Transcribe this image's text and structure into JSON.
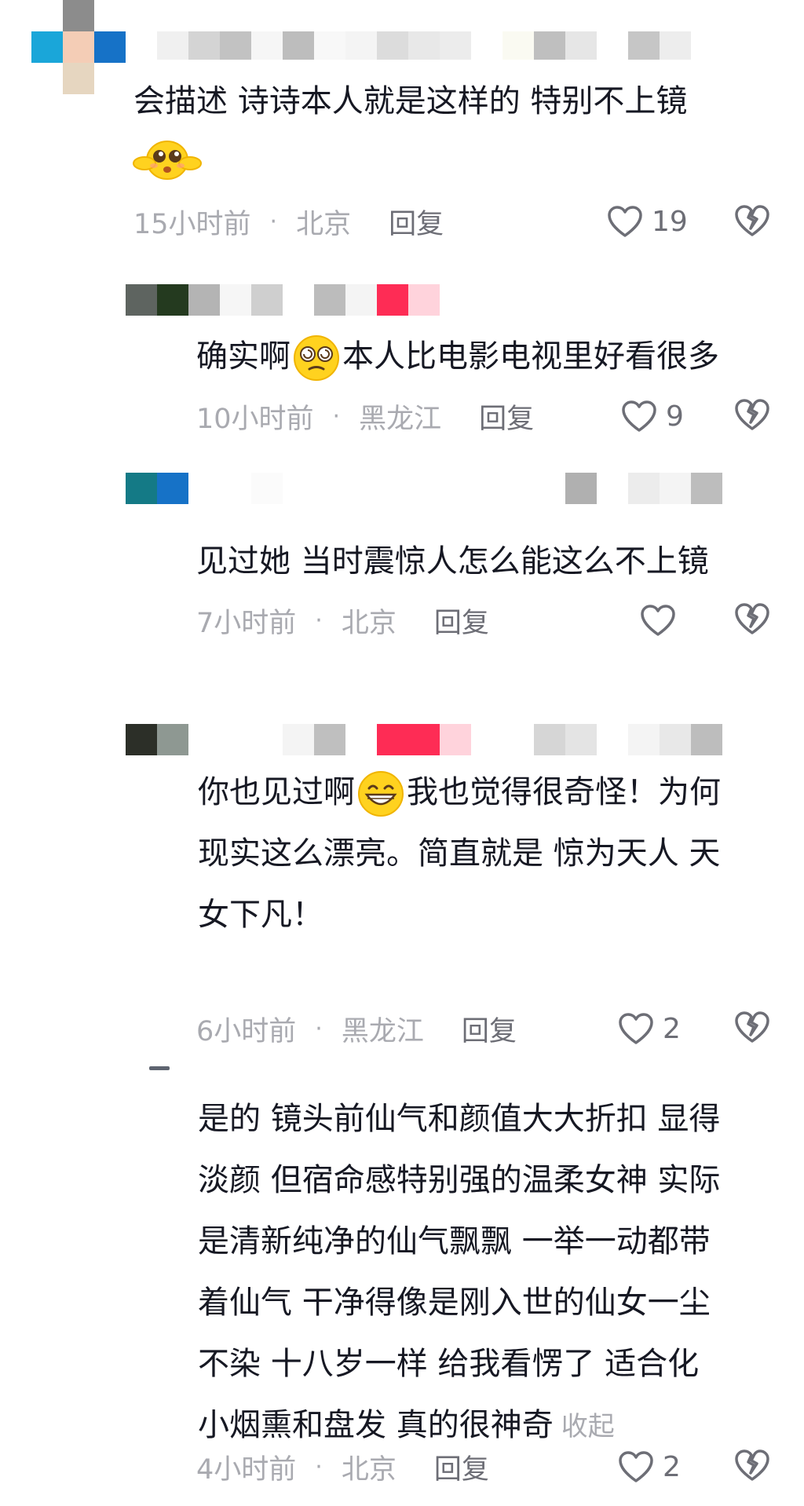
{
  "comments": [
    {
      "id": "c1",
      "text_line1": "会描述 诗诗本人就是这样的 特别不上镜",
      "time": "15小时前",
      "location": "北京",
      "reply_label": "回复",
      "likes": "19"
    },
    {
      "id": "c2",
      "text_before_emoji": "确实啊",
      "text_after_emoji": "本人比电影电视里好看很多",
      "emoji": "dizzy-face-emoji",
      "time": "10小时前",
      "location": "黑龙江",
      "reply_label": "回复",
      "likes": "9"
    },
    {
      "id": "c3",
      "text_line1": "见过她 当时震惊人怎么能这么不上镜",
      "time": "7小时前",
      "location": "北京",
      "reply_label": "回复",
      "likes": ""
    },
    {
      "id": "c4",
      "text_line1_before_emoji": "你也见过啊",
      "text_line1_after_emoji": "我也觉得很奇怪！为何",
      "text_line2": "现实这么漂亮。简直就是 惊为天人 天",
      "text_line3": "女下凡！",
      "emoji": "grinning-face-emoji",
      "time": "6小时前",
      "location": "黑龙江",
      "reply_label": "回复",
      "likes": "2"
    },
    {
      "id": "c5",
      "lines": [
        "是的 镜头前仙气和颜值大大折扣 显得",
        "淡颜 但宿命感特别强的温柔女神 实际",
        "是清新纯净的仙气飘飘 一举一动都带",
        "着仙气 干净得像是刚入世的仙女一尘",
        "不染 十八岁一样 给我看愣了 适合化",
        "小烟熏和盘发 真的很神奇"
      ],
      "collapse_label": "收起",
      "time": "4小时前",
      "location": "北京",
      "reply_label": "回复",
      "likes": "2"
    }
  ],
  "colors": {
    "text": "#161823",
    "meta": "#a9aab0",
    "reply": "#6d6e76",
    "accent_pink": "#fe2c55"
  }
}
